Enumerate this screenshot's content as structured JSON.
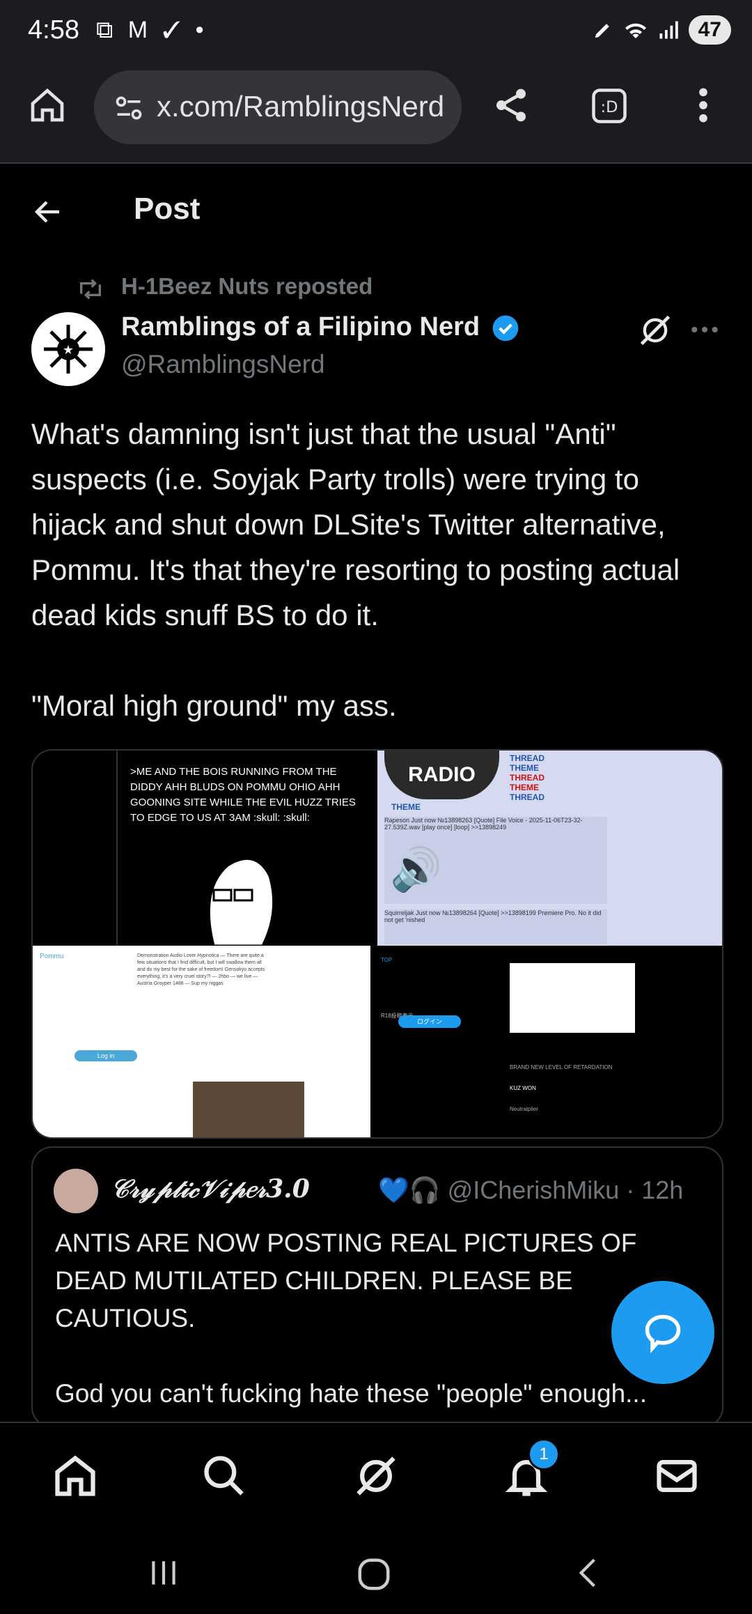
{
  "status_bar": {
    "time": "4:58",
    "left_icons": "⧉ M ✓ •",
    "battery": "47"
  },
  "browser": {
    "url": "x.com/RamblingsNerd",
    "icons": [
      "home-icon",
      "site-settings-icon",
      "share-icon",
      "tab-switcher-icon",
      "menu-icon"
    ]
  },
  "header": {
    "title": "Post"
  },
  "post": {
    "reposted_by": "H-1Beez Nuts reposted",
    "author_name": "Ramblings of a Filipino Nerd",
    "author_handle": "@RamblingsNerd",
    "text_paragraph_1": "What's damning isn't just that the usual \"Anti\" suspects (i.e. Soyjak Party trolls) were trying to hijack and shut down DLSite's Twitter alternative, Pommu. It's that they're resorting to posting actual dead kids snuff BS to do it.",
    "text_paragraph_2": "\"Moral high ground\" my ass."
  },
  "media": {
    "tile1_caption": ">ME AND THE BOIS RUNNING FROM THE DIDDY AHH BLUDS ON POMMU OHIO AHH GOONING SITE WHILE THE EVIL HUZZ TRIES TO EDGE TO US AT 3AM :skull: :skull:",
    "tile2_radio": "RADIO",
    "tile2_thread": [
      "THREAD",
      "THEME",
      "THREAD",
      "THEME",
      "THREAD"
    ],
    "tile2_theme": "THEME",
    "tile2_post1": "Rapeson Just now №13898263 [Quote] File Voice - 2025-11-06T23-32-27.539Z.wav [play once] [loop] >>13898249",
    "tile2_post2": "Squirreljak Just now №13898264 [Quote] >>13898199 Premiere Pro. No it did not get 'nished",
    "tile3_login": "Log in",
    "tile3_feed": "Demonstration Audio Lover Hypnotica — There are quite a few situations that I find difficult, but I will swallow them all and do my best for the sake of freedom! Gensokyo accepts everything, it's a very cruel story?! — 2hbo — we live — Austria Groyper 1488 — Sup my niggas",
    "tile4_menu": [
      "TOP",
      "ログイン",
      "R18投稿表示"
    ],
    "tile4_posts": [
      "BRAND NEW LEVEL OF RETARDATION",
      "KUZ WON",
      "Neutralplier"
    ]
  },
  "quote": {
    "name": "𝒞𝓇𝓎𝓅𝓉𝒾𝒸𝒱𝒾𝓅𝑒𝓇3.0",
    "meta": "💙🎧 @ICherishMiku · 12h",
    "text_paragraph_1": "ANTIS ARE NOW POSTING REAL PICTURES OF DEAD MUTILATED CHILDREN. PLEASE BE CAUTIOUS.",
    "text_paragraph_2": "God you can't fucking hate these \"people\" enough..."
  },
  "bottom_nav": {
    "notification_count": "1",
    "items": [
      "home-icon",
      "search-icon",
      "grok-icon",
      "notifications-icon",
      "messages-icon"
    ]
  },
  "colors": {
    "accent": "#1d9bf0",
    "background": "#000000",
    "secondary_text": "#71767b",
    "primary_text": "#e7e9ea"
  }
}
